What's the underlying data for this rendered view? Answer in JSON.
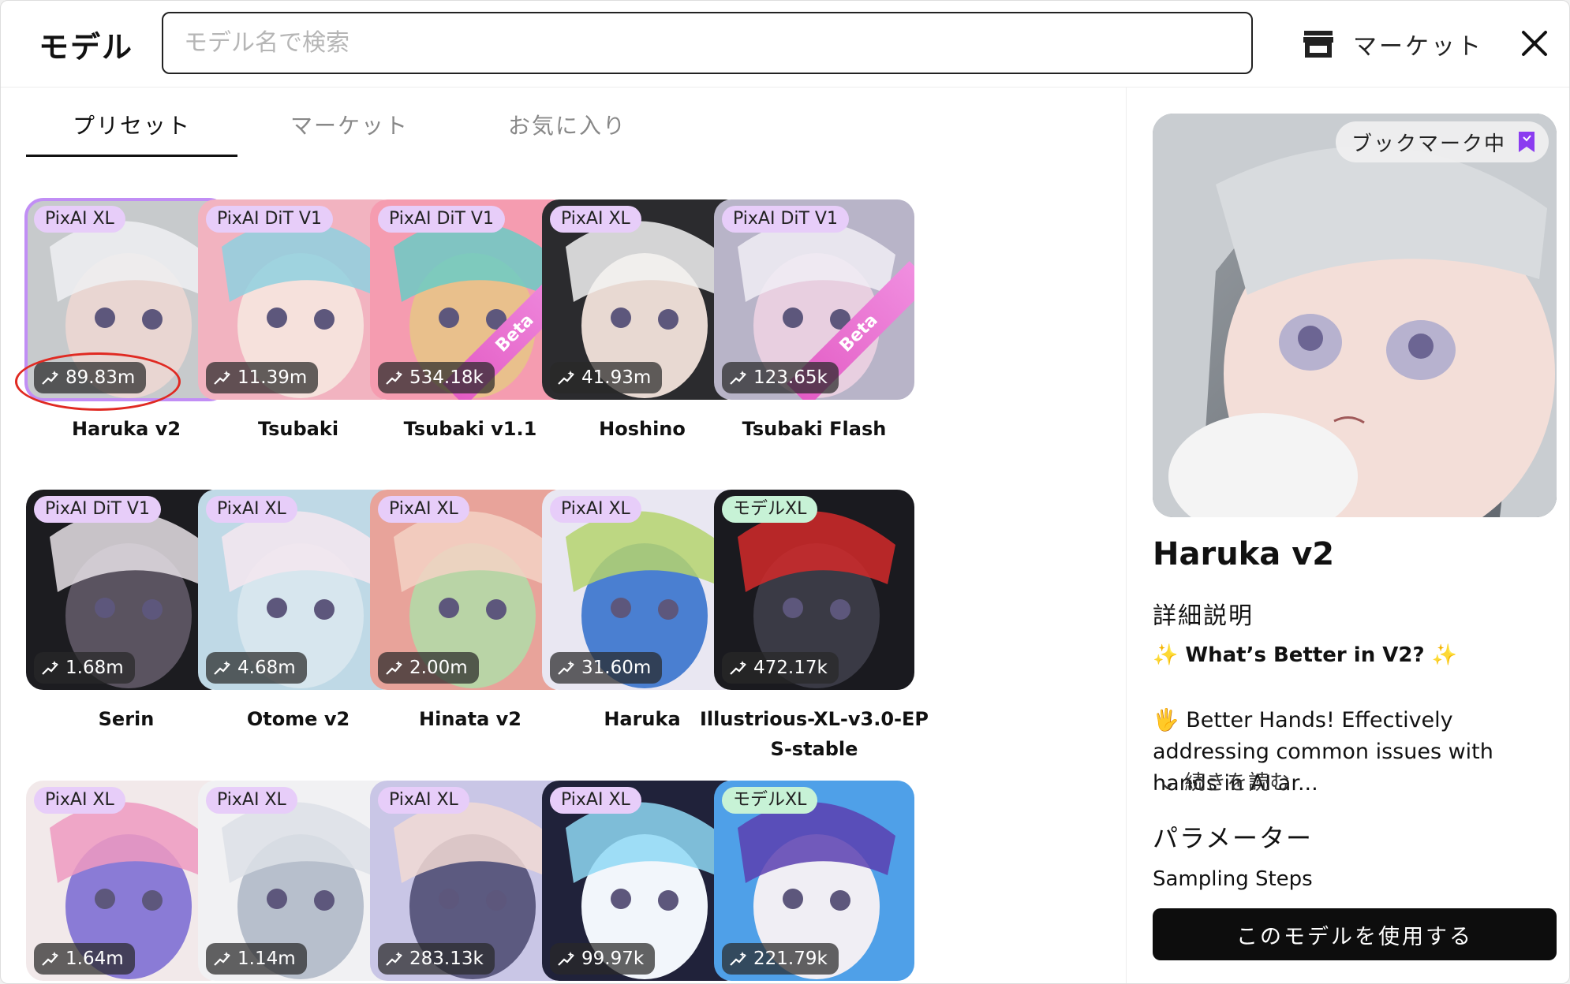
{
  "header": {
    "title": "モデル",
    "search_placeholder": "モデル名で検索",
    "market_label": "マーケット"
  },
  "tabs": [
    {
      "label": "プリセット",
      "active": true
    },
    {
      "label": "マーケット",
      "active": false
    },
    {
      "label": "お気に入り",
      "active": false
    }
  ],
  "models": [
    {
      "name": "Haruka v2",
      "badge": "PixAI XL",
      "count": "89.83m",
      "selected": true
    },
    {
      "name": "Tsubaki",
      "badge": "PixAI DiT V1",
      "count": "11.39m"
    },
    {
      "name": "Tsubaki v1.1",
      "badge": "PixAI DiT V1",
      "count": "534.18k",
      "beta": "Beta"
    },
    {
      "name": "Hoshino",
      "badge": "PixAI XL",
      "count": "41.93m"
    },
    {
      "name": "Tsubaki Flash",
      "badge": "PixAI DiT V1",
      "count": "123.65k",
      "beta": "Beta"
    },
    {
      "name": "Serin",
      "badge": "PixAI DiT V1",
      "count": "1.68m"
    },
    {
      "name": "Otome v2",
      "badge": "PixAI XL",
      "count": "4.68m"
    },
    {
      "name": "Hinata v2",
      "badge": "PixAI XL",
      "count": "2.00m"
    },
    {
      "name": "Haruka",
      "badge": "PixAI XL",
      "count": "31.60m"
    },
    {
      "name": "Illustrious-XL-v3.0-EPS-stable",
      "badge": "モデルXL",
      "count": "472.17k"
    },
    {
      "name": "",
      "badge": "PixAI XL",
      "count": "1.64m"
    },
    {
      "name": "",
      "badge": "PixAI XL",
      "count": "1.14m"
    },
    {
      "name": "",
      "badge": "PixAI XL",
      "count": "283.13k"
    },
    {
      "name": "",
      "badge": "PixAI XL",
      "count": "99.97k"
    },
    {
      "name": "",
      "badge": "モデルXL",
      "count": "221.79k"
    }
  ],
  "detail": {
    "bookmark_label": "ブックマーク中",
    "title": "Haruka v2",
    "section_label": "詳細説明",
    "heading": "✨ What’s Better in V2? ✨",
    "description": "🖐 Better Hands! Effectively addressing common issues with hands in AI ar...",
    "read_more": "続きを読む",
    "params_label": "パラメーター",
    "sampling_label": "Sampling Steps",
    "use_button": "このモデルを使用する"
  },
  "colors": {
    "pixai_badge": "#e7cdf9",
    "model_badge": "#c7f2d6",
    "selected_outline": "#c18ef5",
    "annotation_circle": "#e02a22",
    "beta_ribbon": "#e35bc4"
  }
}
